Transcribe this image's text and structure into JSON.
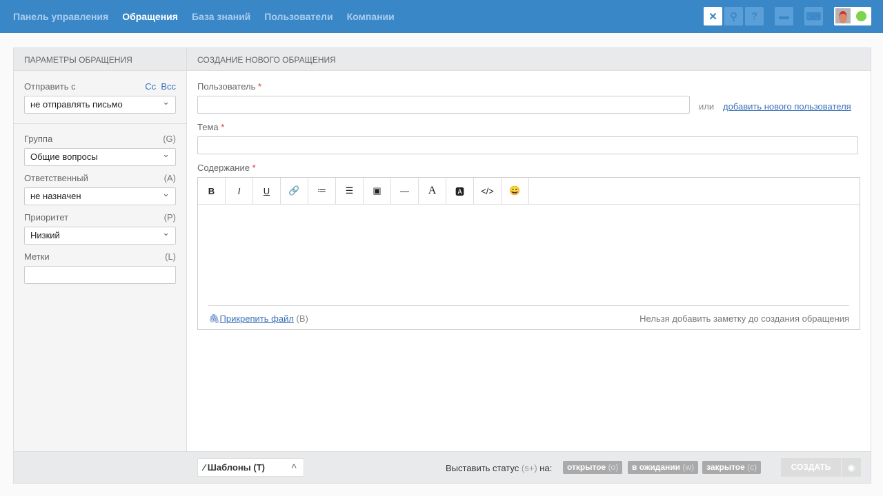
{
  "nav": [
    "Панель управления",
    "Обращения",
    "База знаний",
    "Пользователи",
    "Компании"
  ],
  "toolbar": {
    "close": "✕",
    "search": "⚲",
    "help": "?",
    "case": "▬",
    "keyboard": "⌨"
  },
  "sidebar": {
    "title": "Параметры обращения",
    "send_from": "Отправить с",
    "cc": "Cc",
    "bcc": "Bcc",
    "send_value": "не отправлять письмо",
    "group": "Группа",
    "group_key": "(G)",
    "group_value": "Общие вопросы",
    "assignee": "Ответственный",
    "assignee_key": "(A)",
    "assignee_value": "не назначен",
    "priority": "Приоритет",
    "priority_key": "(P)",
    "priority_value": "Низкий",
    "tags": "Метки",
    "tags_key": "(L)"
  },
  "main": {
    "title": "Создание нового обращения",
    "user": "Пользователь",
    "or": "или",
    "add_user": "добавить нового пользователя",
    "subject": "Тема",
    "content": "Содержание",
    "req": "*",
    "attach": "Прикрепить файл",
    "attach_key": "(B)",
    "note": "Нельзя добавить заметку до создания обращения"
  },
  "editor_tools": [
    "B",
    "I",
    "U",
    "🔗",
    "≔",
    "☰",
    "▣",
    "—",
    "A",
    "🅰",
    "</>",
    "😀"
  ],
  "footer": {
    "templates": "Шаблоны (T)",
    "status_label": "Выставить статус",
    "status_key": "(s+)",
    "status_on": "на:",
    "statuses": [
      {
        "label": "открытое",
        "key": "(o)"
      },
      {
        "label": "в ожидании",
        "key": "(w)"
      },
      {
        "label": "закрытое",
        "key": "(c)"
      }
    ],
    "create": "СОЗДАТЬ"
  }
}
